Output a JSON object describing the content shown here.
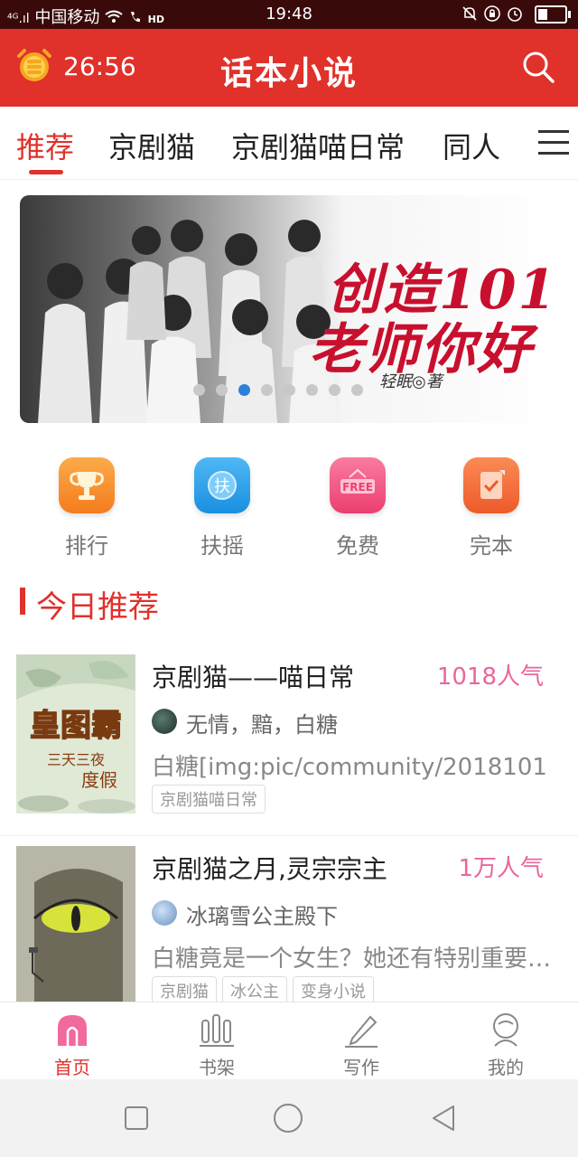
{
  "status_bar": {
    "signal": "⁴ᴳ.ıl",
    "carrier": "中国移动",
    "wifi": "wifi-icon",
    "hd": "HD",
    "time": "19:48",
    "icons": [
      "bell-off-icon",
      "lock-rotate-icon",
      "alarm-icon",
      "battery-icon"
    ]
  },
  "appbar": {
    "timer": "26:56",
    "title": "话本小说",
    "brand_color": "#e0312b"
  },
  "tabs": [
    {
      "label": "推荐",
      "active": true
    },
    {
      "label": "京剧猫",
      "active": false
    },
    {
      "label": "京剧猫喵日常",
      "active": false
    },
    {
      "label": "同人",
      "active": false
    }
  ],
  "banner": {
    "title_line1": "创造101",
    "title_line2": "老师你好",
    "author": "轻眠◎著",
    "slide_count": 9,
    "active_slide": 2
  },
  "quick_entries": [
    {
      "label": "排行",
      "icon": "trophy-icon",
      "color": "#f68b2a"
    },
    {
      "label": "扶摇",
      "icon": "fuyao-icon",
      "color": "#2a9fe8"
    },
    {
      "label": "免费",
      "icon": "free-icon",
      "color": "#f2557f"
    },
    {
      "label": "完本",
      "icon": "checkmark-book-icon",
      "color": "#f26a3a"
    }
  ],
  "section": {
    "title": "今日推荐"
  },
  "books": [
    {
      "title": "京剧猫——喵日常",
      "popularity": "1018人气",
      "authors": "无情，黯，白糖",
      "description": "白糖[img:pic/community/2018101",
      "tags": [
        "京剧猫喵日常"
      ]
    },
    {
      "title": "京剧猫之月,灵宗宗主",
      "popularity": "1万人气",
      "authors": "冰璃雪公主殿下",
      "description": "白糖竟是一个女生？她还有特别重要的身份",
      "tags": [
        "京剧猫",
        "冰公主",
        "变身小说"
      ]
    }
  ],
  "bottom_nav": [
    {
      "label": "首页",
      "icon": "home-icon",
      "active": true
    },
    {
      "label": "书架",
      "icon": "bookshelf-icon",
      "active": false
    },
    {
      "label": "写作",
      "icon": "pen-icon",
      "active": false
    },
    {
      "label": "我的",
      "icon": "profile-icon",
      "active": false
    }
  ],
  "system_nav": [
    "recent-apps-icon",
    "home-circle-icon",
    "back-icon"
  ]
}
